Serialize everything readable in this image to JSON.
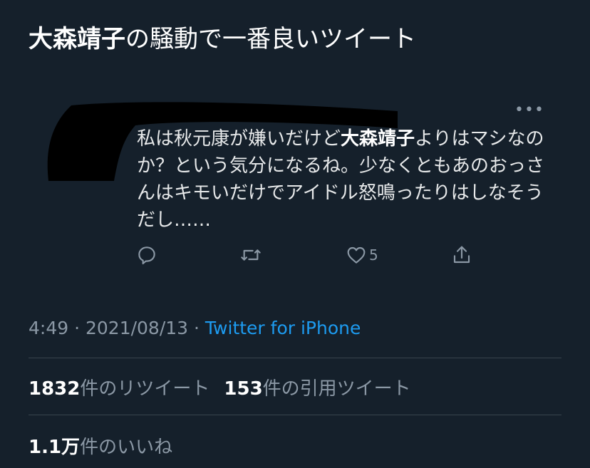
{
  "title": {
    "name_bold": "大森靖子",
    "rest": "の騒動で一番良いツイート"
  },
  "quoted_tweet": {
    "more_glyph": "•••",
    "text_before": "私は秋元康が嫌いだけど",
    "text_bold": "大森靖子",
    "text_after": "よりはマシなのか？という気分になるね。少なくともあのおっさんはキモいだけでアイドル怒鳴ったりはしなそうだし……",
    "like_count": "5",
    "icons": [
      "reply-icon",
      "retweet-icon",
      "like-icon",
      "share-icon"
    ]
  },
  "meta": {
    "time": "4:49",
    "sep1": " · ",
    "date": "2021/08/13",
    "sep2": " · ",
    "source": "Twitter for iPhone"
  },
  "stats": {
    "retweets_count": "1832",
    "retweets_label": "件のリツイート",
    "quotes_count": "153",
    "quotes_label": "件の引用ツイート",
    "likes_count": "1.1万",
    "likes_label": "件のいいね"
  },
  "colors": {
    "background": "#15202b",
    "secondary_text": "#8b98a5",
    "link": "#1d9bf0",
    "divider": "#38444d"
  }
}
